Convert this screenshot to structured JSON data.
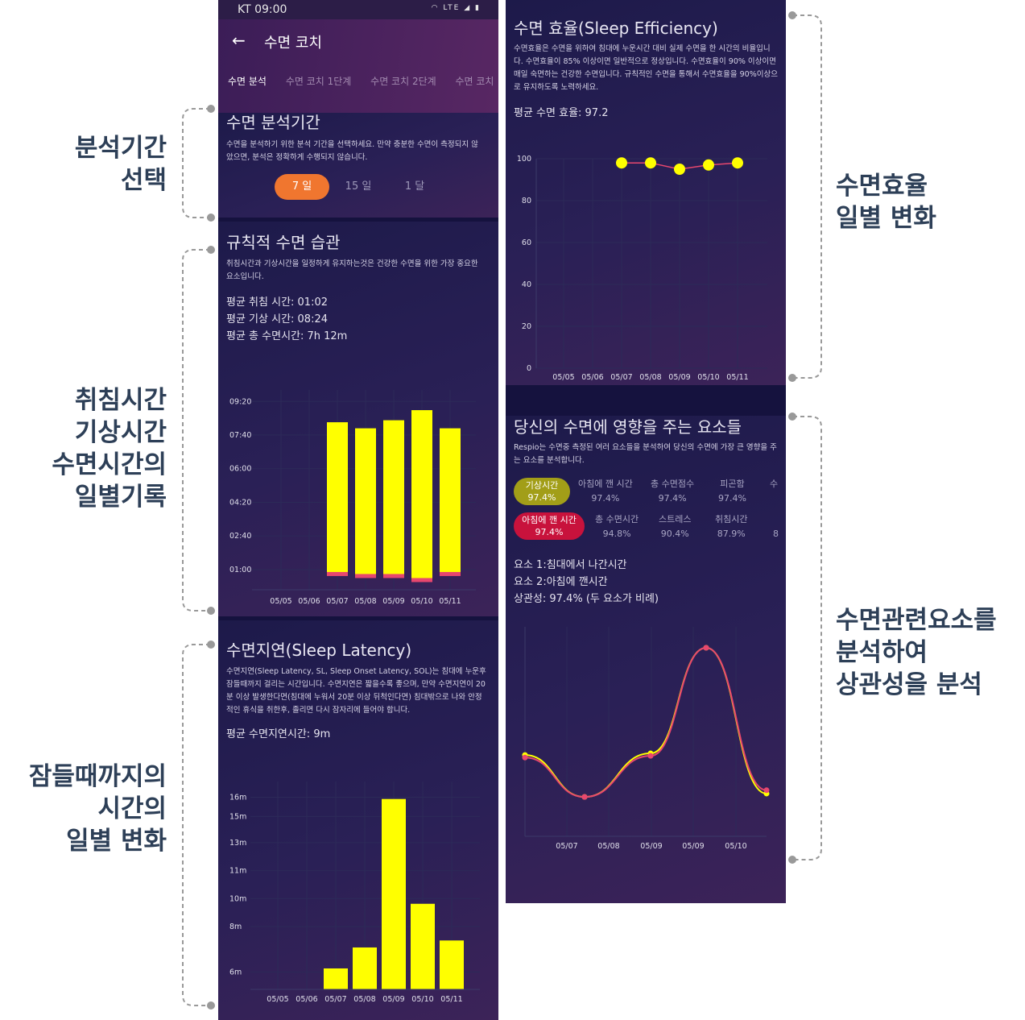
{
  "annotations": {
    "period_select": [
      "분석기간",
      "선택"
    ],
    "daily_record": [
      "취침시간",
      "기상시간",
      "수면시간의",
      "일별기록"
    ],
    "latency_change": [
      "잠들때까지의",
      "시간의",
      "일별 변화"
    ],
    "efficiency_change": [
      "수면효율",
      "일별 변화"
    ],
    "correlation": [
      "수면관련요소를",
      "분석하여",
      "상관성을 분석"
    ]
  },
  "status_bar": {
    "carrier_time": "KT 09:00",
    "network": "LTE"
  },
  "app_bar": {
    "title": "수면 코치"
  },
  "tabs": [
    "수면 분석",
    "수면 코치 1단계",
    "수면 코치 2단계",
    "수면 코치"
  ],
  "period": {
    "title": "수면 분석기간",
    "description": "수면을 분석하기 위한 분석 기간을 선택하세요. 만약 충분한 수면이 측정되지 않았으면, 분석은 정확하게 수행되지 않습니다.",
    "options": [
      "7 일",
      "15 일",
      "1 달"
    ],
    "selected": "7 일"
  },
  "regular": {
    "title": "규칙적 수면 습관",
    "description": "취침시간과 기상시간을 일정하게 유지하는것은 건강한 수면을 위한 가장 중요한 요소입니다.",
    "avg_bed": "평균 취침 시간: 01:02",
    "avg_wake": "평균 기상 시간: 08:24",
    "avg_total": "평균 총 수면시간: 7h 12m"
  },
  "latency": {
    "title": "수면지연(Sleep Latency)",
    "description": "수면지연(Sleep Latency, SL, Sleep Onset Latency, SOL)는 침대에 누운후 잠들때까지 걸리는 시간입니다. 수면지연은 짧을수록 좋으며, 만약 수면지연이 20분 이상 발생한다면(침대에 누워서 20분 이상 뒤척인다면) 침대밖으로 나와 안정적인 휴식을 취한후, 졸리면 다시 잠자리에 들어야 합니다.",
    "avg": "평균 수면지연시간: 9m"
  },
  "efficiency": {
    "title": "수면 효율(Sleep Efficiency)",
    "description": "수면효율은 수면을 위하여 침대에 누운시간 대비 실제 수면을 한 시간의 비율입니다. 수면효율이 85% 이상이면 일반적으로 정상입니다. 수면효율이 90% 이상이면 매일 숙면하는 건강한 수면입니다. 규칙적인 수면을 통해서 수면효율을 90%이상으로 유지하도록 노력하세요.",
    "avg": "평균 수면 효율: 97.2"
  },
  "factors": {
    "title": "당신의 수면에 영향을 주는 요소들",
    "description": "Respio는 수면중 측정된 여러 요소들을 분석하여 당신의 수면에 가장 큰 영향을 주는 요소를 분석합니다.",
    "row1": [
      {
        "name": "기상시간",
        "value": "97.4%",
        "style": "olive"
      },
      {
        "name": "아침에 깬 시간",
        "value": "97.4%"
      },
      {
        "name": "총 수면점수",
        "value": "97.4%"
      },
      {
        "name": "피곤함",
        "value": "97.4%"
      },
      {
        "name": "수",
        "value": ""
      }
    ],
    "row2": [
      {
        "name": "아침에 깬 시간",
        "value": "97.4%",
        "style": "red"
      },
      {
        "name": "총 수면시간",
        "value": "94.8%"
      },
      {
        "name": "스트레스",
        "value": "90.4%"
      },
      {
        "name": "취침시간",
        "value": "87.9%"
      },
      {
        "name": "8",
        "value": ""
      }
    ],
    "factor1": "요소 1:침대에서 나간시간",
    "factor2": "요소 2:아침에 깬시간",
    "correlation": "상관성: 97.4% (두 요소가 비례)"
  },
  "colors": {
    "bar": "#ffff00",
    "accent_orange": "#f0762f",
    "line_pink": "#e8476e",
    "panel_bg": "#15123e"
  },
  "chart_data": [
    {
      "id": "bed_wake",
      "type": "bar",
      "categories": [
        "05/05",
        "05/06",
        "05/07",
        "05/08",
        "05/09",
        "05/10",
        "05/11"
      ],
      "yticks": [
        "09:20",
        "07:40",
        "06:00",
        "04:20",
        "02:40",
        "01:00"
      ],
      "series": [
        {
          "values": [
            null,
            null,
            [
              0.8,
              8.3
            ],
            [
              0.7,
              8.0
            ],
            [
              0.7,
              8.4
            ],
            [
              0.5,
              8.9
            ],
            [
              0.8,
              8.0
            ]
          ]
        }
      ],
      "ylim": [
        0,
        9.9
      ]
    },
    {
      "id": "latency",
      "type": "bar",
      "categories": [
        "05/05",
        "05/06",
        "05/07",
        "05/08",
        "05/09",
        "05/10",
        "05/11"
      ],
      "yticks": [
        "16m",
        "15m",
        "13m",
        "11m",
        "10m",
        "8m",
        "6m"
      ],
      "values": [
        null,
        null,
        6.2,
        7.4,
        15.9,
        9.9,
        7.8
      ],
      "ylim": [
        5.0,
        16.9
      ]
    },
    {
      "id": "efficiency",
      "type": "scatter",
      "categories": [
        "05/05",
        "05/06",
        "05/07",
        "05/08",
        "05/09",
        "05/10",
        "05/11"
      ],
      "values": [
        null,
        null,
        98,
        98,
        95,
        97,
        98
      ],
      "ylim": [
        0,
        100
      ],
      "yticks": [
        0,
        20,
        40,
        60,
        80,
        100
      ]
    },
    {
      "id": "correlation",
      "type": "line",
      "categories": [
        "05/07",
        "05/08",
        "05/09",
        "05/09",
        "05/10"
      ],
      "series": [
        {
          "color": "yellow",
          "values": [
            0.28,
            0.78,
            0.26,
            -1.0,
            0.74
          ]
        },
        {
          "color": "pink",
          "values": [
            0.31,
            0.78,
            0.29,
            -1.0,
            0.7
          ]
        }
      ]
    }
  ]
}
